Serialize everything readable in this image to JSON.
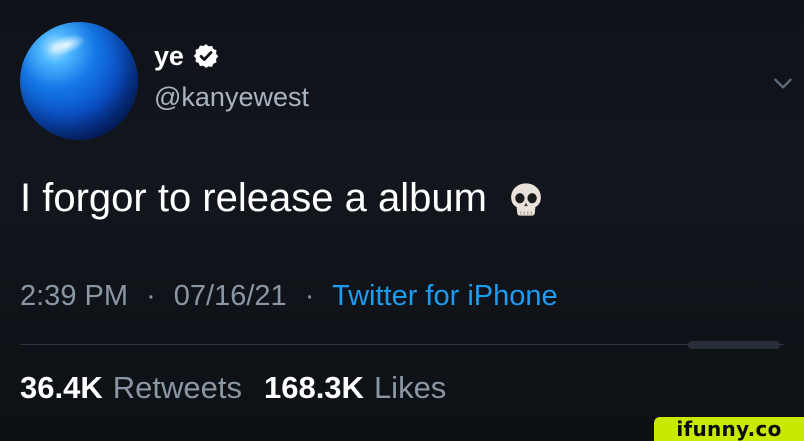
{
  "tweet": {
    "display_name": "ye",
    "handle": "@kanyewest",
    "text": "I forgor to release a album",
    "emoji_icon": "skull-icon",
    "verified_icon": "verified-icon",
    "more_icon": "chevron-down-icon",
    "time": "2:39 PM",
    "date": "07/16/21",
    "source": "Twitter for iPhone",
    "separator": "·"
  },
  "stats": {
    "retweets_value": "36.4K",
    "retweets_label": "Retweets",
    "likes_value": "168.3K",
    "likes_label": "Likes"
  },
  "watermark": {
    "text": "ifunny.co"
  },
  "colors": {
    "background": "#0e1116",
    "text": "#ffffff",
    "secondary_text": "#8a96a3",
    "link": "#1d9bf0",
    "watermark_bg": "#c8ea00",
    "verified_badge": "#ffffff"
  }
}
